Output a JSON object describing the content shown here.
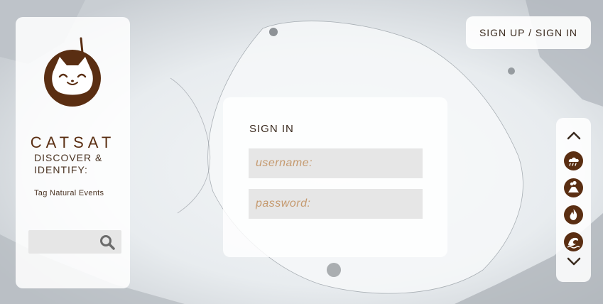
{
  "brand": {
    "name": "CATSAT"
  },
  "sidebar": {
    "tagline": "DISCOVER & IDENTIFY:",
    "subtagline": "Tag Natural Events",
    "search": {
      "value": "",
      "placeholder": ""
    }
  },
  "header": {
    "auth_button": "SIGN UP / SIGN IN"
  },
  "signin": {
    "title": "SIGN IN",
    "username_placeholder": "username:",
    "password_placeholder": "password:"
  },
  "rail": {
    "items": [
      "storm-cloud-icon",
      "volcano-icon",
      "wildfire-icon",
      "flood-wave-icon"
    ]
  },
  "colors": {
    "brand_brown": "#5a2e12",
    "accent_tan": "#c59a6f",
    "panel": "#ffffff"
  }
}
